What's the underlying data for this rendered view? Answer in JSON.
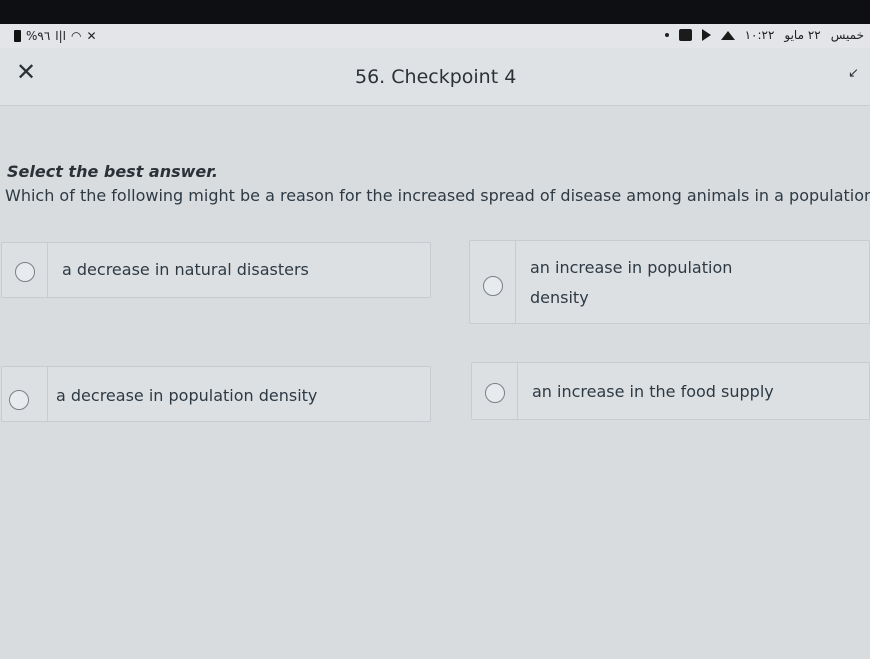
{
  "status_bar": {
    "battery_text": "%٩٦",
    "signal_text": "ا|ا",
    "time": "١٠:٢٢",
    "date": "٢٢ مايو",
    "day": "خميس"
  },
  "header": {
    "title": "56. Checkpoint 4"
  },
  "question": {
    "instruction": "Select the best answer.",
    "text": "Which of the following might be a reason for the increased spread of disease among animals in a population?"
  },
  "options": [
    {
      "label": "a decrease in natural disasters"
    },
    {
      "label": "an increase in population density"
    },
    {
      "label": "a decrease in population density"
    },
    {
      "label": "an increase in the food supply"
    }
  ],
  "icons": {
    "close": "close-icon",
    "collapse": "collapse-arrow-icon"
  }
}
